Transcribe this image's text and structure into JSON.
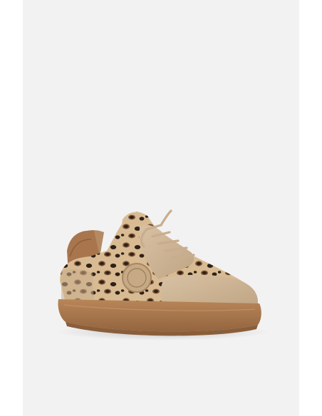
{
  "product_image": {
    "subject": "sneaker-icon",
    "colors": {
      "backdrop": "#f2f2f2",
      "sole": "#b07d52",
      "sole_shadow": "#8a5e3a",
      "leopard_base": "#d9bb93",
      "leopard_spot": "#2e2118",
      "leopard_ring": "#7a5334",
      "suede": "#cdb497",
      "heel_tab": "#a8754d",
      "lace": "#c9ad8c"
    }
  }
}
